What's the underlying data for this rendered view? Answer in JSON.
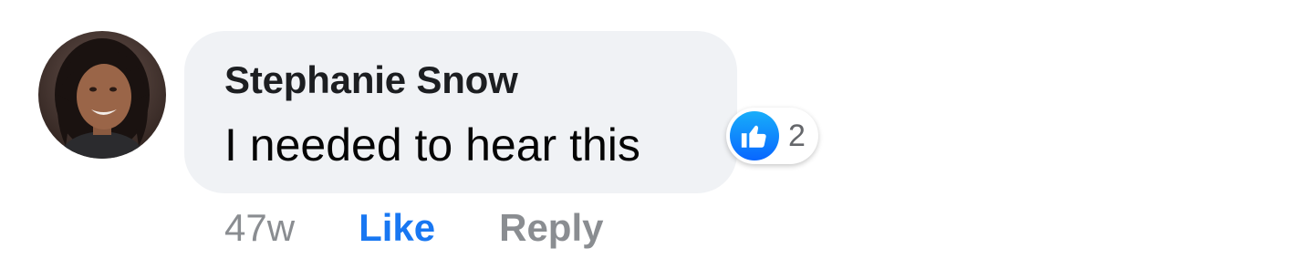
{
  "comment": {
    "author": "Stephanie Snow",
    "text": "I needed to hear this",
    "timestamp": "47w",
    "reactions": {
      "icon": "thumbs-up-icon",
      "count": "2"
    },
    "actions": {
      "like_label": "Like",
      "reply_label": "Reply"
    }
  },
  "colors": {
    "bubble": "#f0f2f5",
    "like_active": "#1877f2",
    "muted": "#8a8d91",
    "author": "#1c1e21"
  }
}
